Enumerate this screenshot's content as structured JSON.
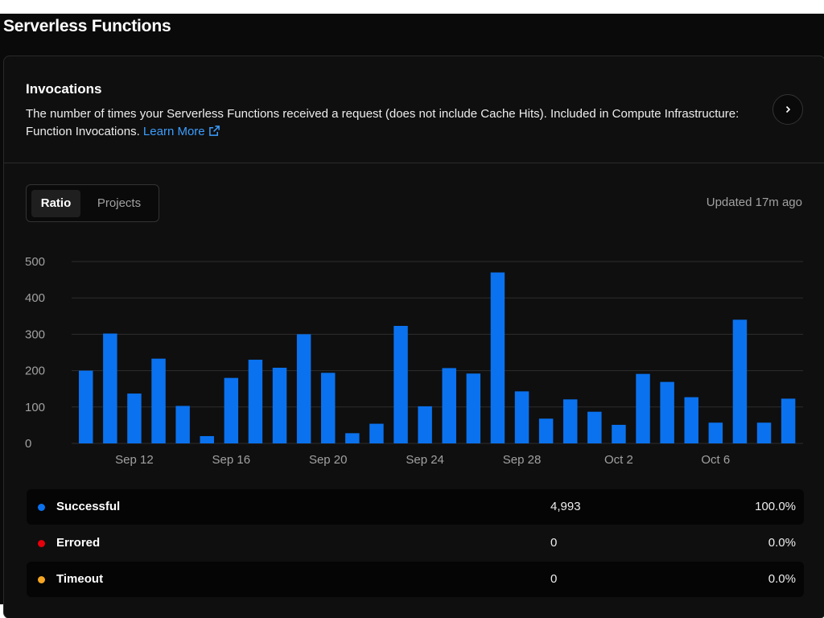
{
  "page": {
    "title": "Serverless Functions"
  },
  "card": {
    "title": "Invocations",
    "description": "The number of times your Serverless Functions received a request (does not include Cache Hits). Included in Compute Infrastructure: Function Invocations.",
    "learn_more_label": "Learn More",
    "next_icon": "chevron-right-icon",
    "external_icon": "external-link-icon"
  },
  "toolbar": {
    "tabs": [
      {
        "label": "Ratio",
        "active": true
      },
      {
        "label": "Projects",
        "active": false
      }
    ],
    "updated_text": "Updated 17m ago"
  },
  "colors": {
    "bar": "#0a72ef",
    "successful": "#0a72ef",
    "errored": "#e5000b",
    "timeout": "#f5a623",
    "link": "#3b9eff"
  },
  "chart_data": {
    "type": "bar",
    "title": "",
    "xlabel": "",
    "ylabel": "",
    "ylim": [
      0,
      500
    ],
    "yticks": [
      0,
      100,
      200,
      300,
      400,
      500
    ],
    "xtick_labels": [
      "Sep 12",
      "Sep 16",
      "Sep 20",
      "Sep 24",
      "Sep 28",
      "Oct 2",
      "Oct 6"
    ],
    "categories": [
      "Sep 10",
      "Sep 11",
      "Sep 12",
      "Sep 13",
      "Sep 14",
      "Sep 15",
      "Sep 16",
      "Sep 17",
      "Sep 18",
      "Sep 19",
      "Sep 20",
      "Sep 21",
      "Sep 22",
      "Sep 23",
      "Sep 24",
      "Sep 25",
      "Sep 26",
      "Sep 27",
      "Sep 28",
      "Sep 29",
      "Sep 30",
      "Oct 1",
      "Oct 2",
      "Oct 3",
      "Oct 4",
      "Oct 5",
      "Oct 6",
      "Oct 7",
      "Oct 8",
      "Oct 9"
    ],
    "series": [
      {
        "values": [
          200,
          302,
          137,
          233,
          103,
          20,
          180,
          230,
          208,
          300,
          194,
          28,
          54,
          323,
          102,
          207,
          192,
          470,
          143,
          68,
          121,
          87,
          51,
          191,
          169,
          127,
          57,
          340,
          57,
          123
        ]
      }
    ],
    "grid": true,
    "legend": "none"
  },
  "legend": [
    {
      "name": "Successful",
      "count": "4,993",
      "percent": "100.0%",
      "color": "#0a72ef"
    },
    {
      "name": "Errored",
      "count": "0",
      "percent": "0.0%",
      "color": "#e5000b"
    },
    {
      "name": "Timeout",
      "count": "0",
      "percent": "0.0%",
      "color": "#f5a623"
    }
  ]
}
